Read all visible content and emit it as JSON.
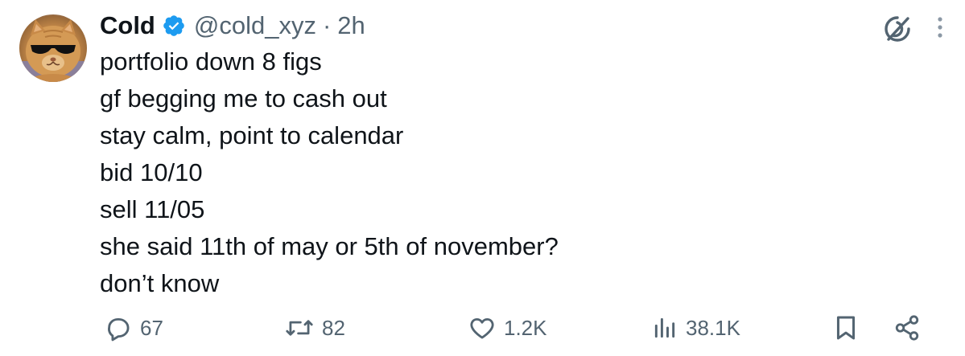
{
  "post": {
    "author": {
      "display_name": "Cold",
      "handle": "@cold_xyz",
      "separator": "·",
      "time": "2h",
      "verified": true,
      "avatar": "sunglasses-cat-avatar"
    },
    "lines": [
      "portfolio down 8 figs",
      "gf begging me to cash out",
      "stay calm, point to calendar",
      "bid 10/10",
      "sell 11/05",
      "she said 11th of may or 5th of november?",
      "don’t know"
    ],
    "stats": {
      "replies": "67",
      "reposts": "82",
      "likes": "1.2K",
      "views": "38.1K"
    },
    "icons": {
      "verified": "verified-badge-icon",
      "grok": "grok-icon",
      "more": "more-options-icon",
      "reply": "reply-icon",
      "repost": "repost-icon",
      "like": "heart-icon",
      "views": "views-icon",
      "bookmark": "bookmark-icon",
      "share": "share-icon"
    }
  },
  "colors": {
    "text": "#0f1419",
    "secondary": "#536471",
    "verified": "#1d9bf0",
    "background": "#ffffff"
  }
}
